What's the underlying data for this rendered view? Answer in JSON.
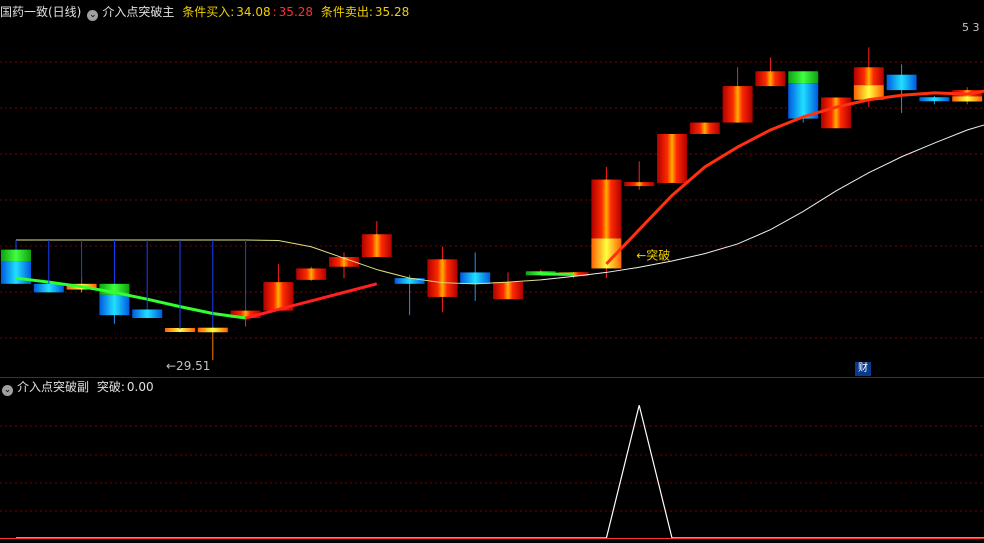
{
  "main_header": {
    "stock": "国药一致(日线)",
    "indicator": "介入点突破主",
    "buy_label": "条件买入:",
    "buy_value": "34.08",
    "mid_value": "35.28",
    "sell_label": "条件卖出:",
    "sell_value": "35.28",
    "right_text": "5 3"
  },
  "sub_header": {
    "indicator": "介入点突破副",
    "label": "突破:",
    "value": "0.00"
  },
  "badge": "财",
  "colors": {
    "up_red": "#e01010",
    "down_blue": "#18b8ff",
    "green": "#20e020",
    "yellow": "#ffd000",
    "grid": "#7a0000",
    "header_yellow": "#f0d000"
  },
  "chart_data": [
    {
      "type": "candlestick",
      "title": "介入点突破主",
      "annotations": [
        {
          "text": "←29.51",
          "candle_index": 5
        },
        {
          "text": "←突破",
          "candle_index": 19
        }
      ],
      "candles": [
        {
          "o": 31.45,
          "c": 30.85,
          "h": 31.6,
          "l": 30.85,
          "color": "blue_green"
        },
        {
          "o": 30.85,
          "c": 30.7,
          "h": 30.85,
          "l": 30.7,
          "color": "blue"
        },
        {
          "o": 30.85,
          "c": 30.75,
          "h": 30.95,
          "l": 30.7,
          "color": "yellow"
        },
        {
          "o": 30.85,
          "c": 30.3,
          "h": 30.85,
          "l": 30.15,
          "color": "blue_green"
        },
        {
          "o": 30.4,
          "c": 30.25,
          "h": 30.4,
          "l": 30.25,
          "color": "blue"
        },
        {
          "o": 30.06,
          "c": 30.02,
          "h": 30.1,
          "l": 30.0,
          "color": "yellow"
        },
        {
          "o": 30.08,
          "c": 30.0,
          "h": 30.12,
          "l": 29.51,
          "color": "yellow"
        },
        {
          "o": 30.25,
          "c": 30.38,
          "h": 30.4,
          "l": 30.1,
          "color": "red"
        },
        {
          "o": 30.38,
          "c": 30.88,
          "h": 31.2,
          "l": 30.38,
          "color": "red"
        },
        {
          "o": 30.92,
          "c": 31.12,
          "h": 31.15,
          "l": 30.9,
          "color": "red"
        },
        {
          "o": 31.15,
          "c": 31.32,
          "h": 31.4,
          "l": 30.95,
          "color": "red"
        },
        {
          "o": 31.32,
          "c": 31.72,
          "h": 31.95,
          "l": 31.32,
          "color": "red"
        },
        {
          "o": 30.95,
          "c": 30.85,
          "h": 31.0,
          "l": 30.3,
          "color": "blue"
        },
        {
          "o": 30.62,
          "c": 31.28,
          "h": 31.5,
          "l": 30.35,
          "color": "red"
        },
        {
          "o": 31.05,
          "c": 30.85,
          "h": 31.4,
          "l": 30.55,
          "color": "blue"
        },
        {
          "o": 30.58,
          "c": 30.88,
          "h": 31.05,
          "l": 30.58,
          "color": "red"
        },
        {
          "o": 31.02,
          "c": 31.05,
          "h": 31.1,
          "l": 31.0,
          "color": "green"
        },
        {
          "o": 31.02,
          "c": 31.02,
          "h": 31.02,
          "l": 30.95,
          "color": "red"
        },
        {
          "o": 31.12,
          "c": 32.68,
          "h": 32.9,
          "l": 30.95,
          "color": "red_yellow"
        },
        {
          "o": 32.62,
          "c": 32.58,
          "h": 33.0,
          "l": 32.5,
          "color": "red"
        },
        {
          "o": 32.62,
          "c": 33.48,
          "h": 33.48,
          "l": 32.62,
          "color": "red"
        },
        {
          "o": 33.48,
          "c": 33.68,
          "h": 33.68,
          "l": 33.48,
          "color": "red"
        },
        {
          "o": 33.68,
          "c": 34.32,
          "h": 34.65,
          "l": 33.68,
          "color": "red"
        },
        {
          "o": 34.32,
          "c": 34.58,
          "h": 34.82,
          "l": 34.32,
          "color": "red"
        },
        {
          "o": 34.58,
          "c": 33.75,
          "h": 34.58,
          "l": 33.68,
          "color": "blue_green"
        },
        {
          "o": 33.58,
          "c": 34.12,
          "h": 34.12,
          "l": 33.58,
          "color": "red"
        },
        {
          "o": 34.08,
          "c": 34.65,
          "h": 35.0,
          "l": 33.95,
          "color": "red_yellow"
        },
        {
          "o": 34.52,
          "c": 34.25,
          "h": 34.7,
          "l": 33.85,
          "color": "blue"
        },
        {
          "o": 34.1,
          "c": 34.08,
          "h": 34.15,
          "l": 34.0,
          "color": "blue"
        },
        {
          "o": 34.05,
          "c": 34.25,
          "h": 34.3,
          "l": 34.0,
          "color": "red_yellow"
        },
        {
          "o": 34.38,
          "c": 35.08,
          "h": 35.28,
          "l": 34.15,
          "color": "red"
        }
      ],
      "line_slow": [
        31.62,
        31.62,
        31.62,
        31.62,
        31.62,
        31.62,
        31.62,
        31.62,
        31.61,
        31.5,
        31.3,
        31.1,
        30.95,
        30.87,
        30.85,
        30.88,
        30.92,
        30.98,
        31.05,
        31.14,
        31.25,
        31.38,
        31.55,
        31.8,
        32.12,
        32.48,
        32.8,
        33.08,
        33.32,
        33.55,
        33.72
      ],
      "line_fast": [
        30.95,
        30.88,
        30.8,
        30.7,
        30.58,
        30.45,
        30.33,
        30.25,
        30.4,
        30.55,
        30.7,
        30.85,
        null,
        null,
        null,
        null,
        31.02,
        31.02,
        31.2,
        31.8,
        32.4,
        32.9,
        33.25,
        33.55,
        33.78,
        33.95,
        34.08,
        34.16,
        34.2,
        34.18,
        34.28
      ],
      "ylim": [
        29.25,
        35.48
      ]
    },
    {
      "type": "line",
      "title": "介入点突破副",
      "x": [
        0,
        1,
        2,
        3,
        4,
        5,
        6,
        7,
        8,
        9,
        10,
        11,
        12,
        13,
        14,
        15,
        16,
        17,
        18,
        19,
        20,
        21,
        22,
        23,
        24,
        25,
        26,
        27,
        28,
        29,
        30
      ],
      "values": [
        0,
        0,
        0,
        0,
        0,
        0,
        0,
        0,
        0,
        0,
        0,
        0,
        0,
        0,
        0,
        0,
        0,
        0,
        0,
        1,
        0,
        0,
        0,
        0,
        0,
        0,
        0,
        0,
        0,
        0,
        0
      ],
      "ylim": [
        0,
        1.1
      ]
    }
  ]
}
